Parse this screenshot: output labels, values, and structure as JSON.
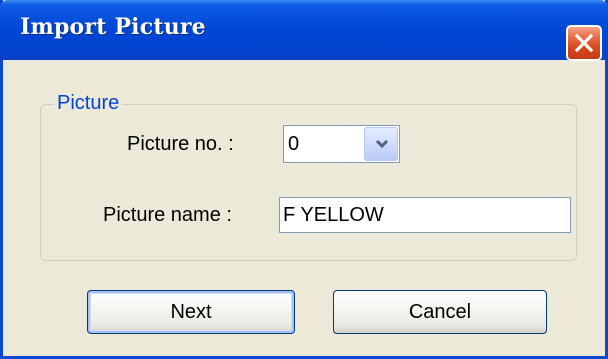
{
  "window": {
    "title": "Import Picture",
    "close_icon": "close-x-icon",
    "accent_color": "#0046d5",
    "close_color": "#d6441c"
  },
  "group": {
    "legend": "Picture"
  },
  "picture_no": {
    "label": "Picture no. :",
    "value": "0",
    "arrow_icon": "chevron-down-icon"
  },
  "picture_name": {
    "label": "Picture name :",
    "value": "F YELLOW"
  },
  "buttons": {
    "next": "Next",
    "cancel": "Cancel"
  }
}
